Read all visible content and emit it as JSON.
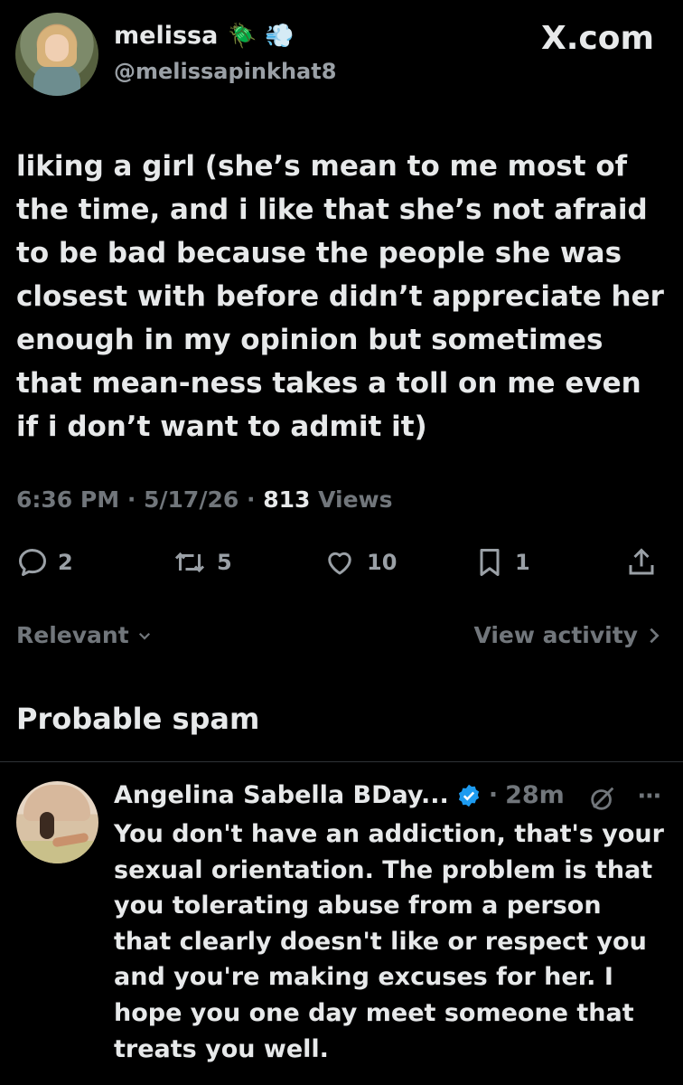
{
  "post": {
    "author_name": "melissa",
    "author_emojis": "🪲 💨",
    "author_handle": "@melissapinkhat8",
    "site_label": "X.com",
    "text": "liking a girl (she’s mean to me most of the time, and i like that she’s not afraid to be bad because the people she was closest with before didn’t appreciate her enough in my opinion but sometimes that mean-ness takes a toll on me even if i don’t want to admit it)",
    "time": "6:36 PM",
    "date": "5/17/26",
    "views_count": "813",
    "views_label": "Views",
    "actions": {
      "replies": "2",
      "reposts": "5",
      "likes": "10",
      "bookmarks": "1"
    }
  },
  "sort": {
    "label": "Relevant",
    "view_activity": "View activity"
  },
  "section": {
    "title": "Probable spam"
  },
  "reply": {
    "author_name": "Angelina Sabella BDay...",
    "time": "28m",
    "text": "You don't have an addiction, that's your sexual orientation. The problem is that you tolerating abuse from a person that clearly doesn't like or respect you and you're making excuses for her. I hope you one day meet someone that treats you well."
  },
  "colors": {
    "background": "#000000",
    "primary_text": "#e7e9ea",
    "secondary_text": "#71767b",
    "verified_badge": "#1d9bf0",
    "divider": "#2f3336"
  },
  "icons": [
    "reply-icon",
    "repost-icon",
    "like-icon",
    "bookmark-icon",
    "share-icon",
    "chevron-down-icon",
    "chevron-right-icon",
    "verified-badge-icon",
    "grok-icon",
    "more-icon"
  ]
}
